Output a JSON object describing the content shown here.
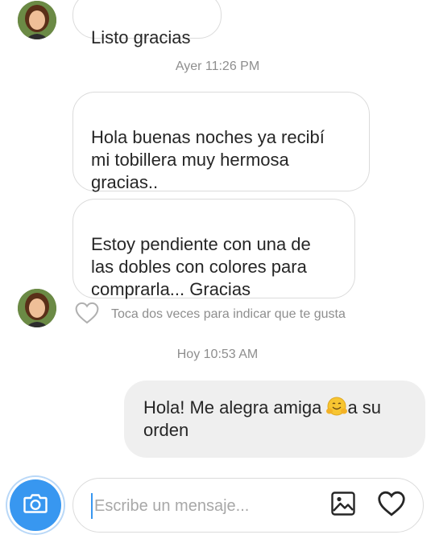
{
  "thread": {
    "messages": [
      {
        "text": "Listo gracias"
      },
      {
        "text": "Hola buenas noches ya recibí\nmi tobillera muy hermosa\ngracias.."
      },
      {
        "text": "Estoy pendiente con una de\nlas dobles con colores para\ncomprarla... Gracias"
      }
    ],
    "timestamp_1": "Ayer 11:26 PM",
    "timestamp_2": "Hoy 10:53 AM",
    "like_hint": "Toca dos veces para indicar que te gusta",
    "reply": {
      "text_before": "Hola! Me alegra amiga ",
      "emoji": "hugging-face-emoji",
      "text_after": "a su orden"
    }
  },
  "composer": {
    "placeholder": "Escribe un mensaje...",
    "camera_icon": "camera-icon",
    "gallery_icon": "image-icon",
    "like_icon": "heart-icon"
  },
  "colors": {
    "accent": "#3897f0",
    "bubble_border": "#dbdbdb",
    "outgoing_bubble": "#efefef",
    "muted_text": "#8e8e8e"
  }
}
